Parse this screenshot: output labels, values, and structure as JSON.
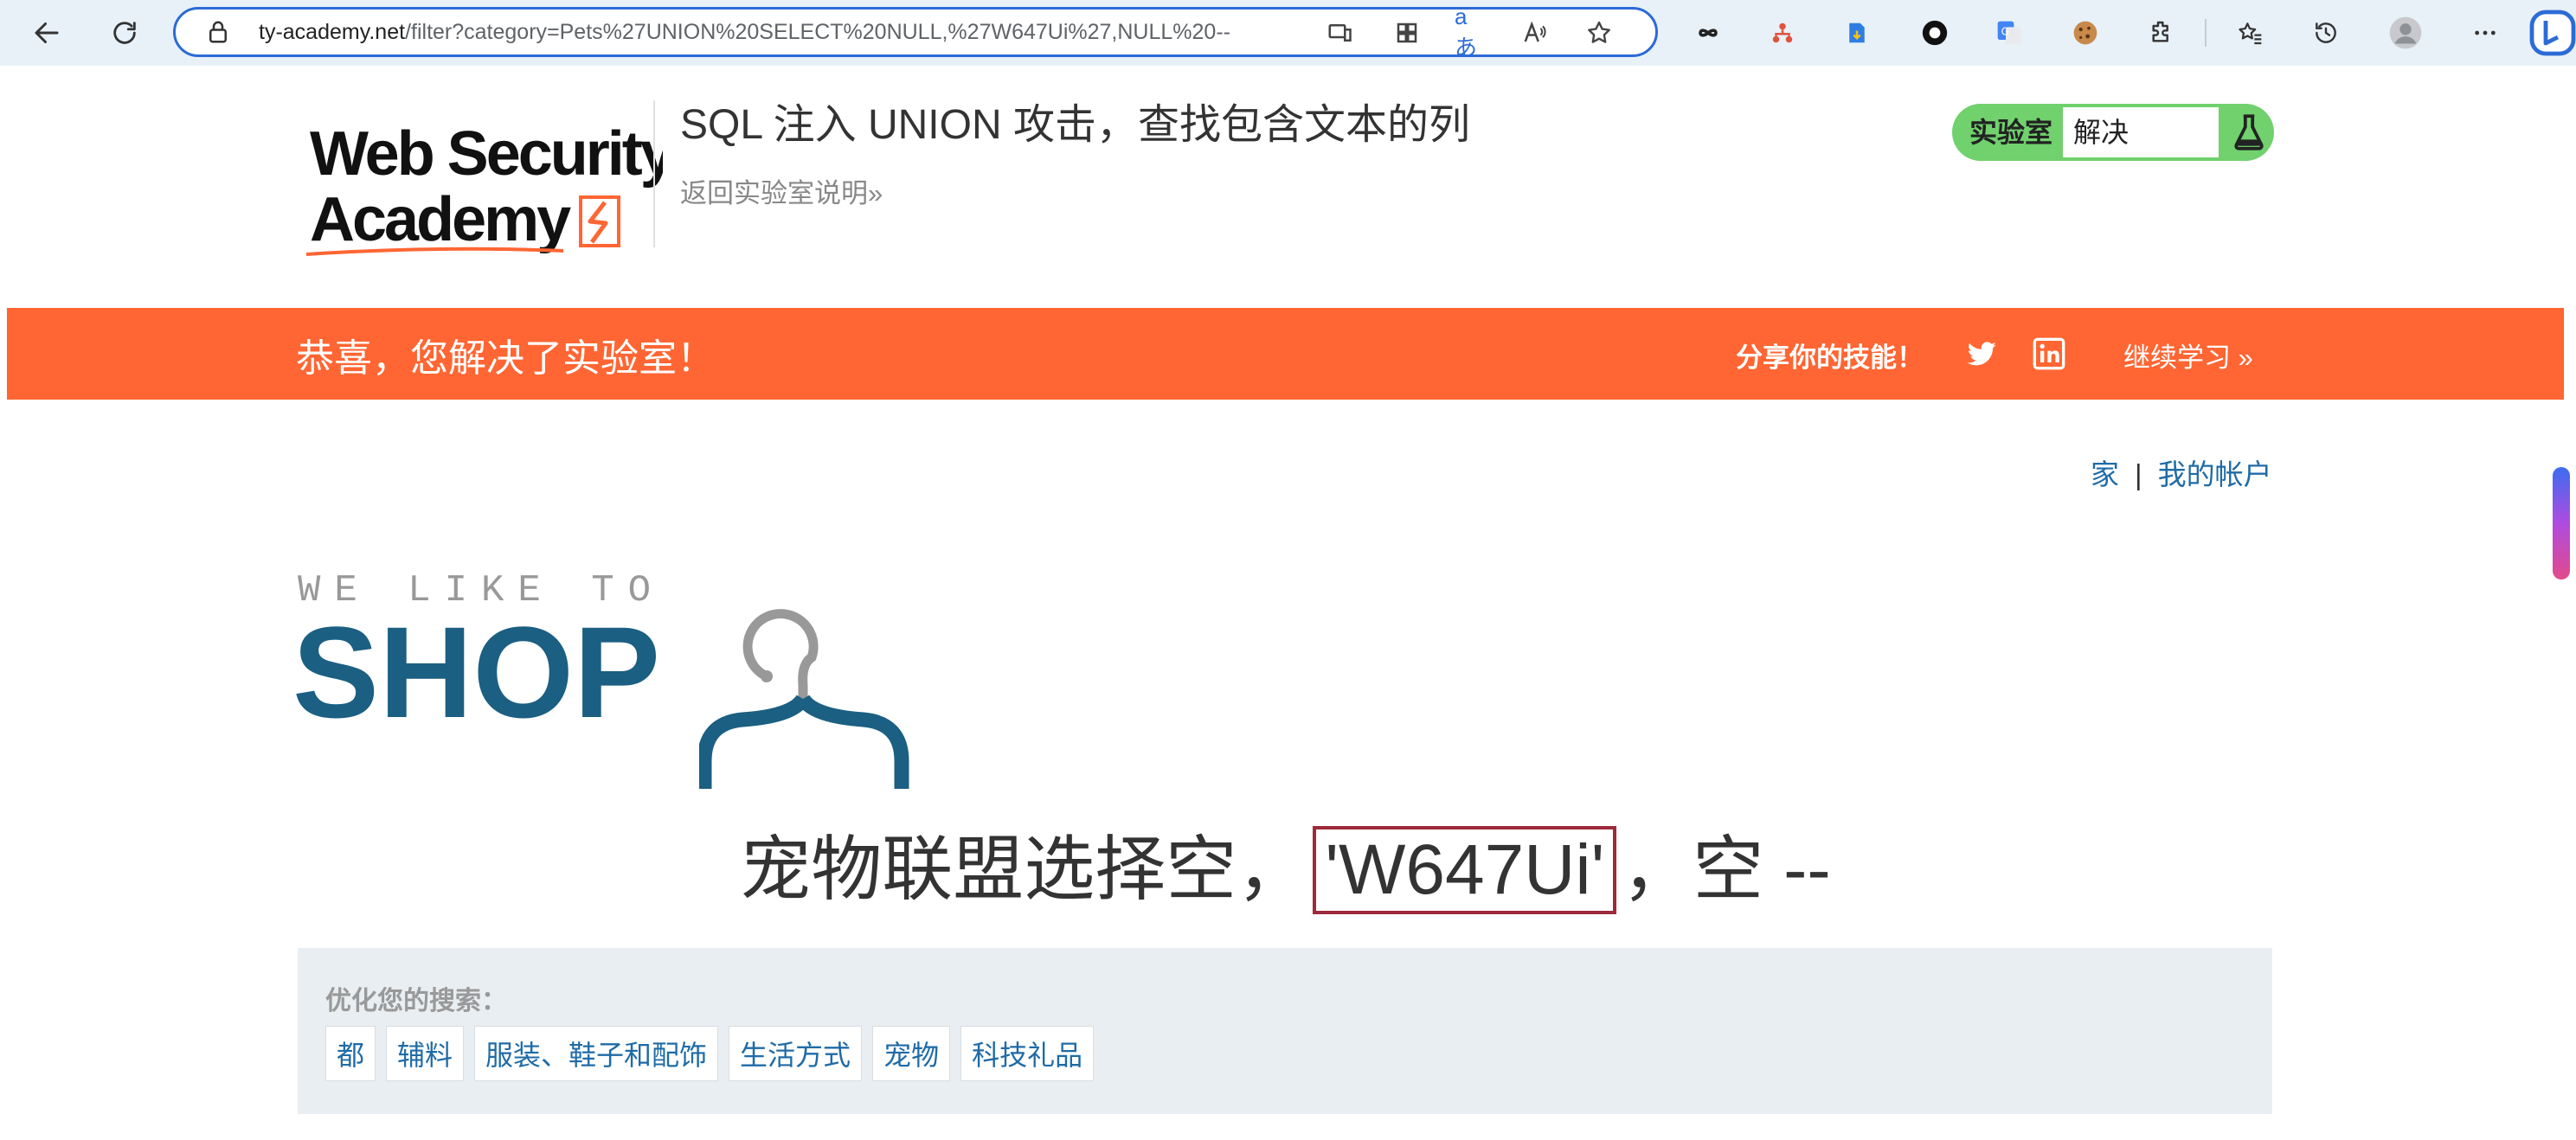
{
  "browser": {
    "url_host": "ty-academy.net",
    "url_path": "/filter?category=Pets%27UNION%20SELECT%20NULL,%27W647Ui%27,NULL%20--",
    "translate_icon_text": "aあ",
    "read_aloud_icon_text": "A̅"
  },
  "lab_header": {
    "title": "SQL 注入 UNION 攻击，查找包含文本的列",
    "back_link": "返回实验室说明»",
    "status_label": "实验室",
    "status_value": "解决"
  },
  "banner": {
    "message": "恭喜，您解决了实验室！",
    "share_text": "分享你的技能！",
    "continue_link": "继续学习 »"
  },
  "top_links": {
    "home": "家",
    "separator": "|",
    "account": "我的帐户"
  },
  "shop_logo": {
    "small_text": "WE LIKE TO",
    "big_text": "SHOP"
  },
  "heading": {
    "prefix": "宠物联盟选择空，",
    "highlight": "'W647Ui'",
    "suffix": "，空 --"
  },
  "filter": {
    "title": "优化您的搜索：",
    "categories": [
      "都",
      "辅料",
      "服装、鞋子和配饰",
      "生活方式",
      "宠物",
      "科技礼品"
    ]
  },
  "colors": {
    "accent_orange": "#ff6633",
    "status_green": "#70d16d",
    "link_blue": "#1f6ba6",
    "shop_blue": "#1b5f82",
    "highlight_red": "#9e2a3c"
  }
}
